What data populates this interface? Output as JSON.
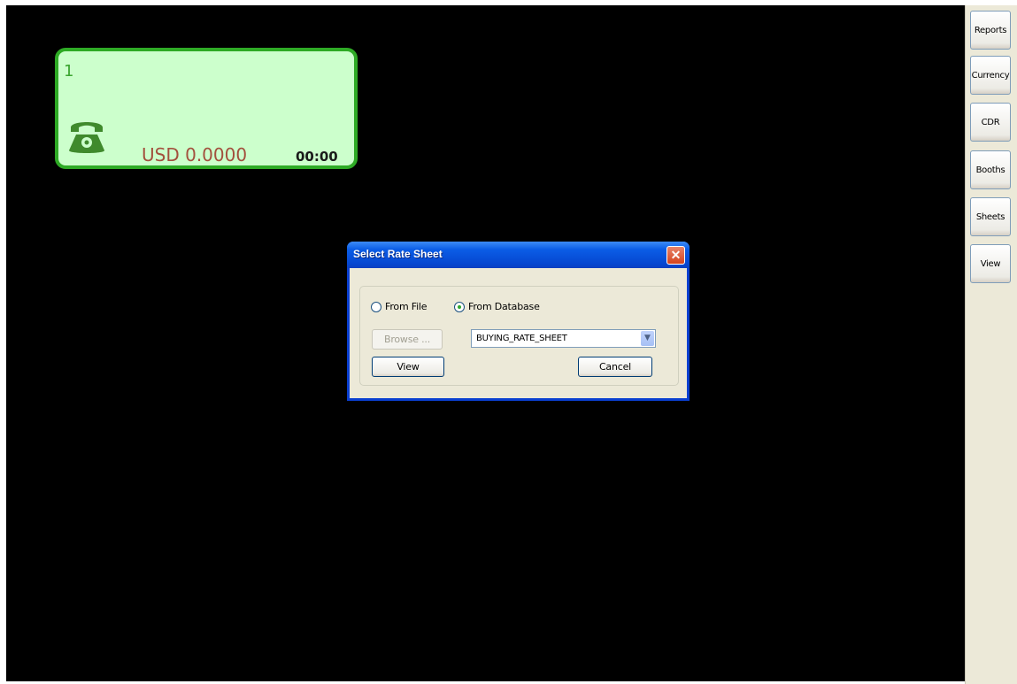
{
  "sidebar": {
    "buttons": [
      {
        "label": "Reports"
      },
      {
        "label": "Currency"
      },
      {
        "label": "CDR"
      },
      {
        "label": "Booths"
      },
      {
        "label": "Sheets"
      },
      {
        "label": "View"
      }
    ]
  },
  "booth": {
    "number": "1",
    "amount": "USD 0.0000",
    "time": "00:00",
    "icon": "phone-icon",
    "color_bg": "#ccffcc",
    "color_border": "#2eaa25"
  },
  "dialog": {
    "title": "Select Rate Sheet",
    "close_icon": "close-icon",
    "radio_file_label": "From File",
    "radio_database_label": "From Database",
    "selected_source": "From Database",
    "browse_label": "Browse ...",
    "select_value": "BUYING_RATE_SHEET",
    "view_label": "View",
    "cancel_label": "Cancel"
  }
}
